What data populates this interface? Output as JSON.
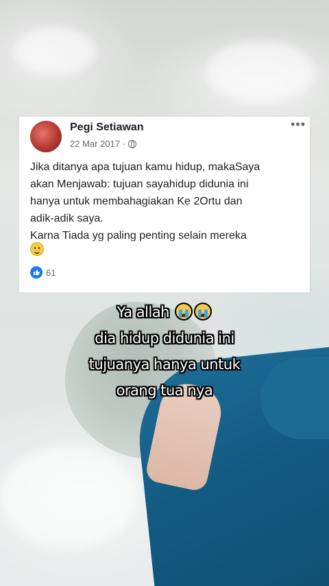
{
  "post": {
    "author": "Pegi Setiawan",
    "date": "22 Mar 2017",
    "privacy_icon": "globe-icon",
    "more_label": "•••",
    "body_lines": [
      "Jika ditanya apa tujuan kamu hidup, makaSaya",
      "akan Menjawab: tujuan sayahidup didunia ini",
      "hanya untuk membahagiakan Ke 2Ortu dan",
      "adik-adik saya.",
      "Karna Tiada yg paling penting selain mereka"
    ],
    "emoji": "smiling-face-icon",
    "like_icon": "like-icon",
    "like_count": "61"
  },
  "caption": {
    "line1": "Ya allah",
    "line1_emoji": "loudly-crying-face-icon",
    "line2": "dia hidup didunia ini",
    "line3": "tujuanya hanya untuk",
    "line4": "orang tua nya"
  },
  "colors": {
    "facebook_blue": "#1877f2",
    "card_bg": "#ffffff",
    "caption_text": "#ffffff",
    "caption_outline": "#000000"
  }
}
